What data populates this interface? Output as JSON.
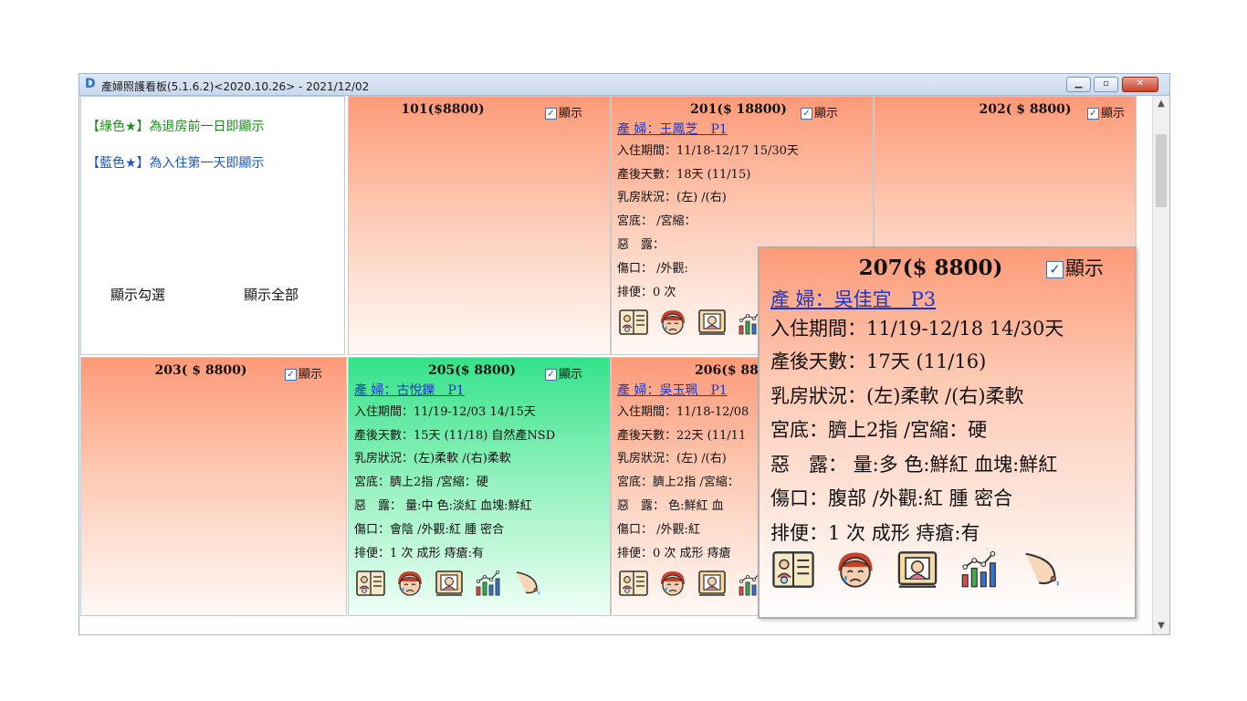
{
  "window": {
    "title": "產婦照護看板(5.1.6.2)<2020.10.26> - 2021/12/02",
    "controls": {
      "minimize": "▁",
      "maximize": "▫",
      "close": "✕"
    }
  },
  "legend": {
    "green_note": "【綠色★】為退房前一日即顯示",
    "blue_note": "【藍色★】為入住第一天即顯示",
    "show_checked_label": "顯示勾選",
    "show_all_label": "顯示全部",
    "green_color": "#1a8f1a",
    "blue_color": "#1a55c8"
  },
  "show_label": "顯示",
  "rooms": {
    "r101": {
      "title": "101($8800)"
    },
    "r201": {
      "title": "201($ 18800)",
      "patient": "產 婦：王鳳芝　P1",
      "stay": "入住期間：11/18-12/17 15/30天",
      "postpartum": "產後天數：18天 (11/15)",
      "breast": "乳房狀況：(左) /(右)",
      "uterus": "宮底： /宮縮：",
      "lochia": "惡　露：",
      "wound": "傷口：  /外觀:",
      "stool": "排便：0 次"
    },
    "r202": {
      "title": "202( $ 8800)"
    },
    "r203": {
      "title": "203( $ 8800)"
    },
    "r205": {
      "title": "205($ 8800)",
      "patient": "產 婦：古悅鑠　P1",
      "stay": "入住期間：11/19-12/03 14/15天",
      "postpartum": "產後天數：15天 (11/18) 自然產NSD",
      "breast": "乳房狀況：(左)柔軟 /(右)柔軟",
      "uterus": "宮底：臍上2指 /宮縮：硬",
      "lochia": "惡　露： 量:中 色:淡紅 血塊:鮮紅",
      "wound": "傷口：會陰  /外觀:紅 腫 密合",
      "stool": "排便：1 次 成形 痔瘡:有"
    },
    "r206": {
      "title": "206($ 8800)",
      "patient": "產 婦：吳玉珮　P1",
      "stay": "入住期間：11/18-12/08",
      "postpartum": "產後天數：22天 (11/11",
      "breast": "乳房狀況：(左) /(右)",
      "uterus": "宮底：臍上2指 /宮縮：",
      "lochia": "惡　露： 色:鮮紅 血",
      "wound": "傷口：  /外觀:紅",
      "stool": "排便：0 次 成形 痔瘡"
    },
    "r207": {
      "title": "207($ 8800)",
      "patient": "產 婦：吳佳宜　P3",
      "stay": "入住期間：11/19-12/18 14/30天",
      "postpartum": "產後天數：17天 (11/16)",
      "breast": "乳房狀況：(左)柔軟 /(右)柔軟",
      "uterus": "宮底：臍上2指 /宮縮：硬",
      "lochia": "惡　露： 量:多 色:鮮紅 血塊:鮮紅",
      "wound": "傷口：腹部  /外觀:紅 腫 密合",
      "stool": "排便：1 次 成形 痔瘡:有"
    }
  },
  "colors": {
    "room_top": "#fd9a78",
    "room_green_top": "#34e28a",
    "patient_link": "#1a36c8"
  }
}
